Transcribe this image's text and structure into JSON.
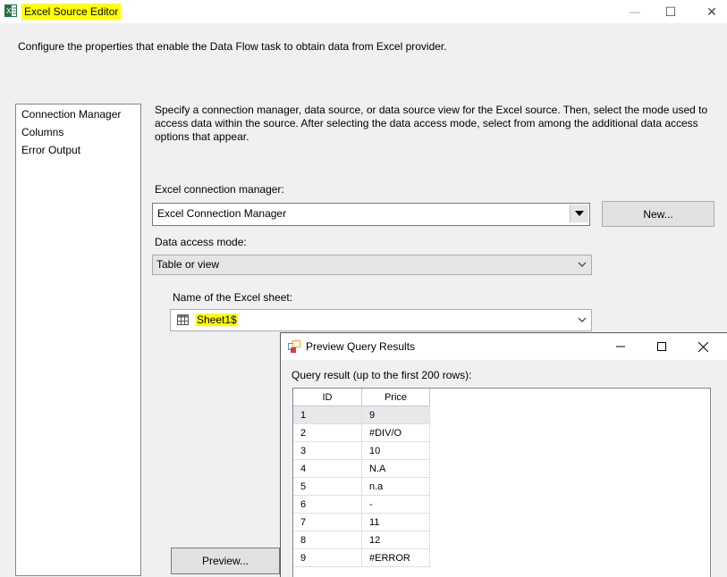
{
  "window": {
    "title": "Excel Source Editor",
    "minimize": "—",
    "maximize": "☐",
    "close": "✕"
  },
  "description": "Configure the properties that enable the Data Flow task to obtain data from Excel provider.",
  "nav": {
    "items": [
      "Connection Manager",
      "Columns",
      "Error Output"
    ]
  },
  "instructions": "Specify a connection manager, data source, or data source view for the Excel source. Then, select the mode used to access data within the source. After selecting the data access mode, select from among the additional data access options that appear.",
  "connection_manager": {
    "label": "Excel connection manager:",
    "value": "Excel Connection Manager",
    "new_button": "New..."
  },
  "data_access_mode": {
    "label": "Data access mode:",
    "value": "Table or view"
  },
  "sheet": {
    "label": "Name of the Excel sheet:",
    "value": "Sheet1$"
  },
  "preview_button": "Preview...",
  "dialog": {
    "title": "Preview Query Results",
    "query_label": "Query result (up to the first 200 rows):",
    "columns": [
      "ID",
      "Price"
    ],
    "rows": [
      {
        "id": "1",
        "price": "9"
      },
      {
        "id": "2",
        "price": "#DIV/O"
      },
      {
        "id": "3",
        "price": "10"
      },
      {
        "id": "4",
        "price": "N.A"
      },
      {
        "id": "5",
        "price": "n.a"
      },
      {
        "id": "6",
        "price": "-"
      },
      {
        "id": "7",
        "price": "11"
      },
      {
        "id": "8",
        "price": "12"
      },
      {
        "id": "9",
        "price": "#ERROR"
      }
    ]
  },
  "colors": {
    "highlight": "#ffff00",
    "excel_green": "#217346"
  }
}
